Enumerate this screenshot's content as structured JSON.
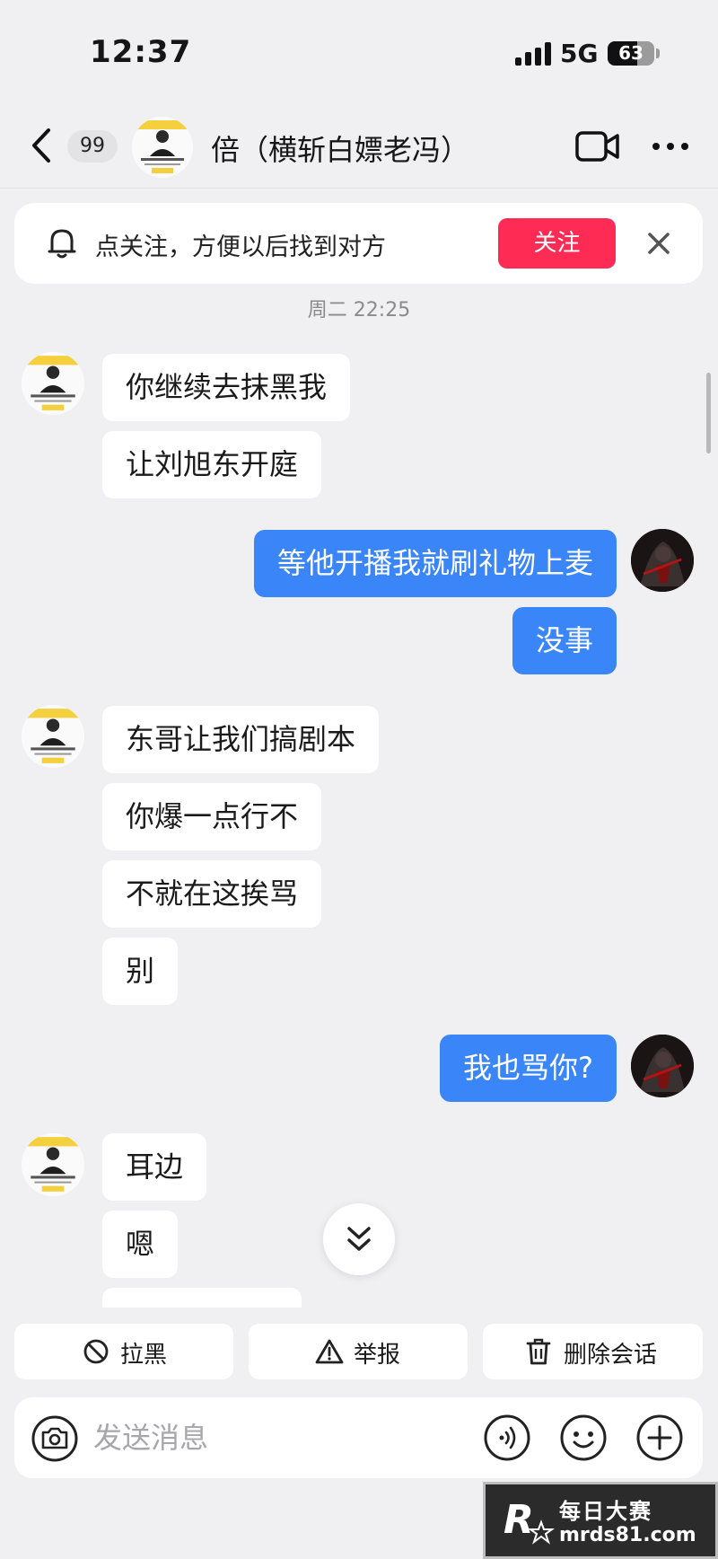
{
  "status_bar": {
    "time": "12:37",
    "network": "5G",
    "battery": "63",
    "battery_level": 0.63
  },
  "header": {
    "unread_count": "99",
    "title": "倍（横斩白嫖老冯）"
  },
  "follow_banner": {
    "text": "点关注，方便以后找到对方",
    "button_label": "关注"
  },
  "chat": {
    "timestamp": "周二 22:25",
    "messages": [
      {
        "side": "in",
        "text": "你继续去抹黑我"
      },
      {
        "side": "in",
        "text": "让刘旭东开庭"
      },
      {
        "side": "out",
        "text": "等他开播我就刷礼物上麦"
      },
      {
        "side": "out",
        "text": "没事"
      },
      {
        "side": "in",
        "text": "东哥让我们搞剧本"
      },
      {
        "side": "in",
        "text": "你爆一点行不"
      },
      {
        "side": "in",
        "text": "不就在这挨骂"
      },
      {
        "side": "in",
        "text": "别"
      },
      {
        "side": "out",
        "text": "我也骂你?"
      },
      {
        "side": "in",
        "text": "耳边"
      },
      {
        "side": "in",
        "text": "嗯"
      }
    ]
  },
  "actions": {
    "block_label": "拉黑",
    "report_label": "举报",
    "delete_label": "删除会话"
  },
  "input_bar": {
    "placeholder": "发送消息",
    "value": ""
  },
  "watermark": {
    "line1": "每日大赛",
    "line2": "mrds81.com"
  },
  "colors": {
    "accent_red": "#fe2c55",
    "outgoing_bubble": "#3a86f8",
    "background": "#f0f0f2"
  }
}
